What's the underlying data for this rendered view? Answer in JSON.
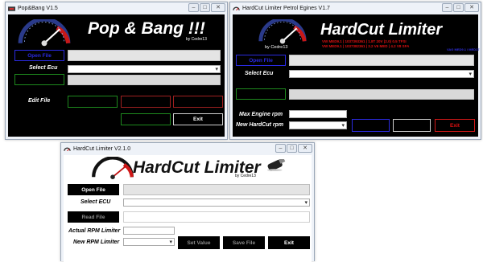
{
  "win_pb": {
    "title": "Pop&Bang  V1.5",
    "heading": "Pop & Bang !!!",
    "byline": "by Cedre13",
    "open_file": "Open File",
    "select_ecu": "Select Ecu",
    "edit_file": "Edit File",
    "exit": "Exit"
  },
  "win_hc17": {
    "title": "HardCut Limiter Petrol Egines V1.7",
    "heading": "HardCut Limiter",
    "byline": "by Cedre13",
    "open_file": "Open File",
    "select_ecu": "Select Ecu",
    "max_engine_rpm": "Max Engine rpm",
    "new_hardcut_rpm": "New HardCut rpm",
    "exit": "Exit",
    "info_r1": "VW MED9.1  | 1037393361 |  1.8T 20V (2.0) 0.5 TFSI",
    "info_r2": "VW MED9.1  | 1037382361 |  3.2 V6 MED | 4.2 V8 SFA",
    "info_right": "VAG MED9.1 / MED17"
  },
  "win_hc21": {
    "title": "HardCut Limiter V2.1.0",
    "heading": "HardCut Limiter",
    "byline": "by Cedre13",
    "open_file": "Open File",
    "select_ecu": "Select ECU",
    "read_file": "Read File",
    "actual_rpm": "Actual RPM Limiter",
    "new_rpm": "New RPM Limiter",
    "set_value": "Set Value",
    "save_file": "Save File",
    "exit": "Exit"
  },
  "colors": {
    "red": "#e01010",
    "blue": "#2a2ae0",
    "green": "#1e8a1e"
  }
}
